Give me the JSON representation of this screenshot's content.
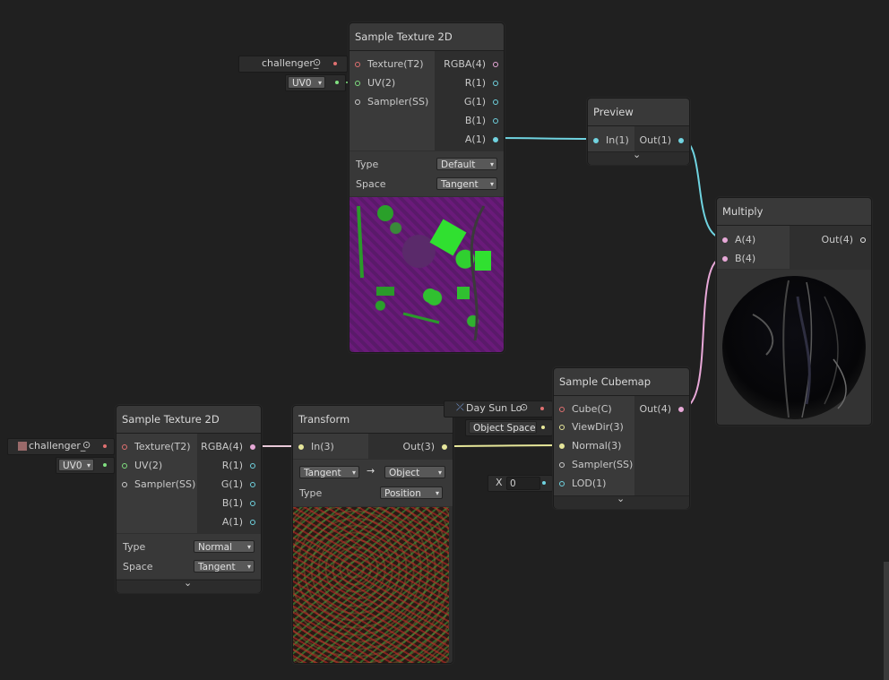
{
  "colors": {
    "background": "#202020",
    "wire_cyan": "#6fd3e0",
    "wire_pink": "#e8a8d8",
    "wire_yellow": "#e8e89a",
    "port_texture": "#e07070",
    "port_uv": "#80e080",
    "port_vector4": "#e8a8d8",
    "port_vector1": "#6fd3e0",
    "port_vector3": "#e8e89a",
    "port_cube": "#e07070"
  },
  "node_top_texture": {
    "title": "Sample Texture 2D",
    "inputs": [
      "Texture(T2)",
      "UV(2)",
      "Sampler(SS)"
    ],
    "outputs": [
      "RGBA(4)",
      "R(1)",
      "G(1)",
      "B(1)",
      "A(1)"
    ],
    "type_label": "Type",
    "type_value": "Default",
    "space_label": "Space",
    "space_value": "Tangent",
    "texture_field": "challenger_",
    "uv_field": "UV0"
  },
  "node_preview": {
    "title": "Preview",
    "input": "In(1)",
    "output": "Out(1)"
  },
  "node_multiply": {
    "title": "Multiply",
    "inputs": [
      "A(4)",
      "B(4)"
    ],
    "output": "Out(4)"
  },
  "node_bottom_texture": {
    "title": "Sample Texture 2D",
    "inputs": [
      "Texture(T2)",
      "UV(2)",
      "Sampler(SS)"
    ],
    "outputs": [
      "RGBA(4)",
      "R(1)",
      "G(1)",
      "B(1)",
      "A(1)"
    ],
    "type_label": "Type",
    "type_value": "Normal",
    "space_label": "Space",
    "space_value": "Tangent",
    "texture_field": "challenger_",
    "uv_field": "UV0"
  },
  "node_transform": {
    "title": "Transform",
    "input": "In(3)",
    "output": "Out(3)",
    "from_value": "Tangent",
    "arrow": "→",
    "to_value": "Object",
    "type_label": "Type",
    "type_value": "Position"
  },
  "node_cubemap": {
    "title": "Sample Cubemap",
    "inputs": [
      "Cube(C)",
      "ViewDir(3)",
      "Normal(3)",
      "Sampler(SS)",
      "LOD(1)"
    ],
    "output": "Out(4)",
    "cube_field": "Day Sun Lo",
    "viewdir_field": "Object Space",
    "lod_label": "X",
    "lod_value": "0"
  },
  "icons": {
    "dropdown": "▾",
    "chevron": "⌄",
    "object_picker": "⊙",
    "arrow": "→"
  }
}
